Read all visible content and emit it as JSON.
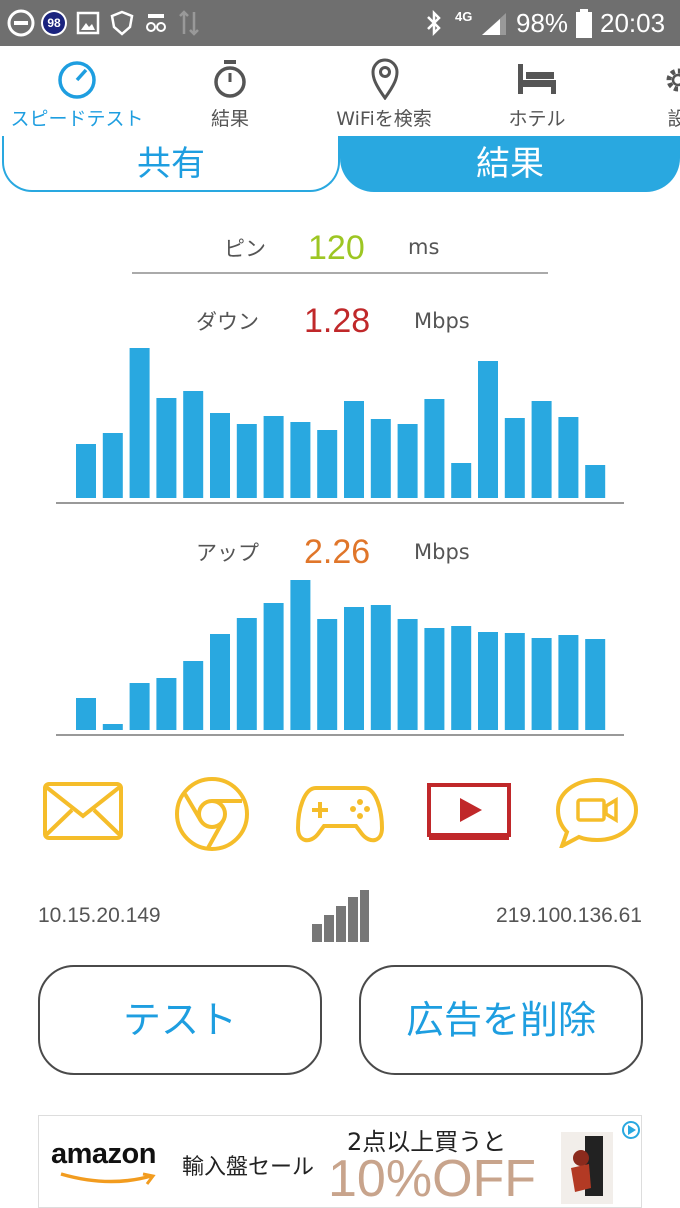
{
  "status_bar": {
    "notification_count": "98",
    "network": "4G",
    "battery": "98%",
    "time": "20:03"
  },
  "tabs": [
    {
      "label": "スピードテスト",
      "icon": "speedometer-icon",
      "active": true
    },
    {
      "label": "結果",
      "icon": "stopwatch-icon",
      "active": false
    },
    {
      "label": "WiFiを検索",
      "icon": "location-pin-icon",
      "active": false
    },
    {
      "label": "ホテル",
      "icon": "bed-icon",
      "active": false
    },
    {
      "label": "設",
      "icon": "settings-icon",
      "active": false
    }
  ],
  "segments": {
    "share": "共有",
    "result": "結果"
  },
  "ping": {
    "label": "ピン",
    "value": "120",
    "unit": "ms",
    "color": "#9dc623"
  },
  "download": {
    "label": "ダウン",
    "value": "1.28",
    "unit": "Mbps",
    "color": "#c0282a"
  },
  "upload": {
    "label": "アップ",
    "value": "2.26",
    "unit": "Mbps",
    "color": "#e0762a"
  },
  "chart_data": [
    {
      "type": "bar",
      "name": "download",
      "values": [
        54,
        65,
        150,
        100,
        107,
        85,
        74,
        82,
        76,
        68,
        97,
        79,
        74,
        99,
        35,
        137,
        80,
        97,
        81,
        33
      ],
      "ylim": [
        0,
        150
      ],
      "color": "#29a8e0"
    },
    {
      "type": "bar",
      "name": "upload",
      "values": [
        32,
        6,
        47,
        52,
        69,
        96,
        112,
        127,
        150,
        111,
        123,
        125,
        111,
        102,
        104,
        98,
        97,
        92,
        95,
        91
      ],
      "ylim": [
        0,
        150
      ],
      "color": "#29a8e0"
    }
  ],
  "app_icons": [
    "mail-icon",
    "browser-icon",
    "gamepad-icon",
    "video-play-icon",
    "video-chat-icon"
  ],
  "network": {
    "local_ip": "10.15.20.149",
    "public_ip": "219.100.136.61",
    "signal_icon": "signal-bars-icon"
  },
  "buttons": {
    "test": "テスト",
    "remove_ads": "広告を削除"
  },
  "ad": {
    "brand": "amazon",
    "text": "輸入盤セール",
    "headline": "2点以上買うと",
    "offer": "10%OFF"
  }
}
